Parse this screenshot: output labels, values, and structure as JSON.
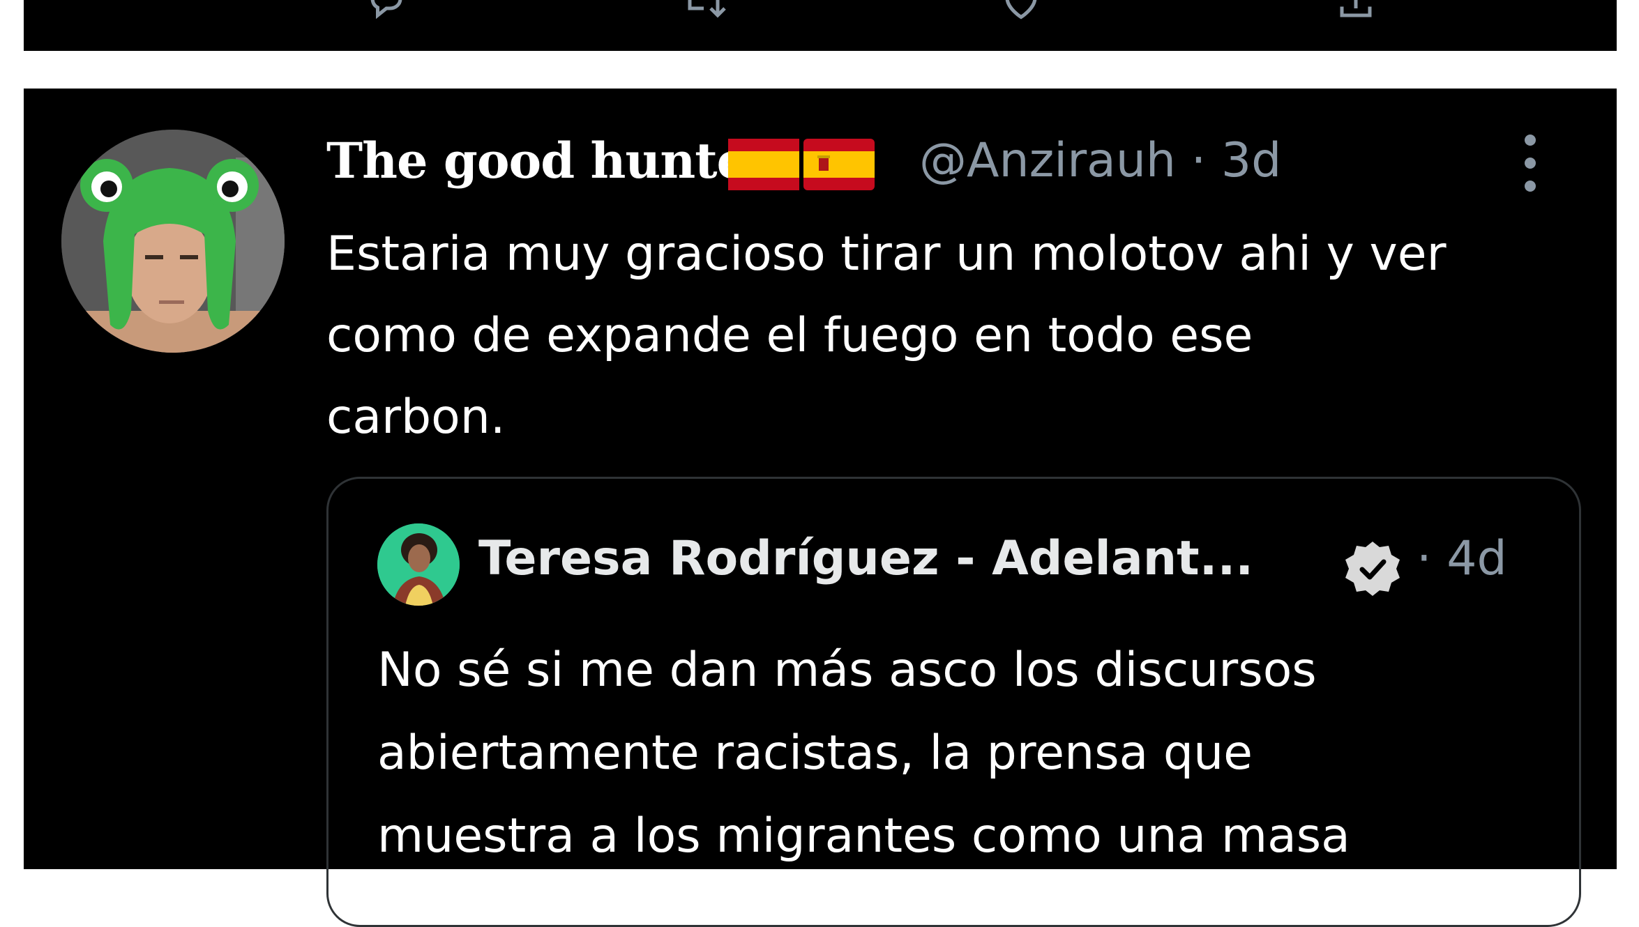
{
  "tweet": {
    "display_name": "The good hunter",
    "handle": "@Anzirauh",
    "separator": "·",
    "time": "3d",
    "text": "Estaria muy gracioso tirar un molotov ahi y ver\ncomo de expande el fuego en todo ese\ncarbon."
  },
  "quoted_tweet": {
    "display_name": "Teresa Rodríguez - Adelant...",
    "separator": "·",
    "time": "4d",
    "text": "No sé si me dan más asco los  discursos\nabiertamente racistas, la prensa que\nmuestra a los migrantes como una masa"
  },
  "icons": {
    "top_actions": [
      "reply-icon",
      "retweet-icon",
      "like-icon",
      "share-icon"
    ],
    "more": "more-vertical-icon",
    "verified": "verified-badge-icon",
    "flags": [
      "spain-flag-icon",
      "spain-flag-icon"
    ]
  },
  "colors": {
    "background": "#000000",
    "text": "#ffffff",
    "muted": "#8b98a5",
    "flag_red": "#c60b1e",
    "flag_yellow": "#ffc400"
  }
}
